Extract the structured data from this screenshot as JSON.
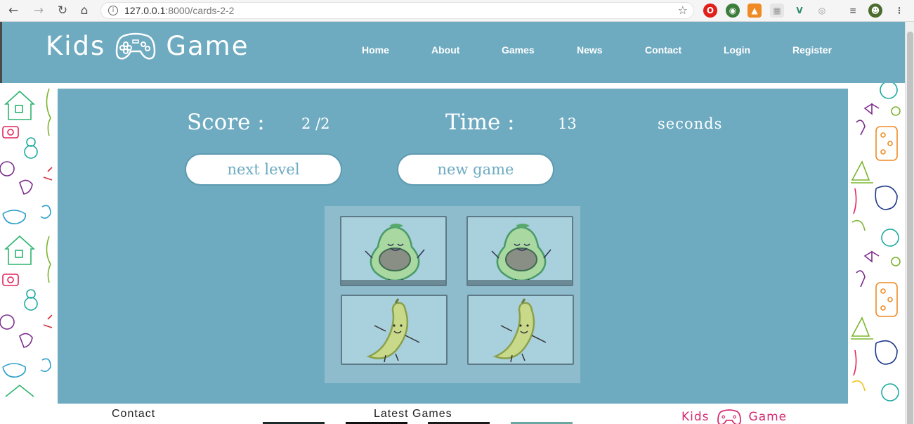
{
  "browser": {
    "url_host": "127.0.0.1",
    "url_rest": ":8000/cards-2-2"
  },
  "header": {
    "logo_left": "Kids",
    "logo_right": "Game",
    "nav": [
      "Home",
      "About",
      "Games",
      "News",
      "Contact",
      "Login",
      "Register"
    ]
  },
  "game": {
    "score_label": "Score :",
    "score_value": "2 /2",
    "time_label": "Time :",
    "time_value": "13",
    "time_unit": "seconds",
    "next_level_label": "next level",
    "new_game_label": "new game",
    "cards": [
      {
        "fruit": "avocado-icon"
      },
      {
        "fruit": "avocado-icon"
      },
      {
        "fruit": "banana-icon"
      },
      {
        "fruit": "banana-icon"
      }
    ]
  },
  "footer": {
    "contact_title": "Contact",
    "latest_title": "Latest Games",
    "logo_left": "Kids",
    "logo_right": "Game"
  },
  "colors": {
    "primary": "#6eabc1",
    "board": "#8ebccd",
    "card": "#a8d0dd",
    "footer_logo": "#d42a6f"
  }
}
